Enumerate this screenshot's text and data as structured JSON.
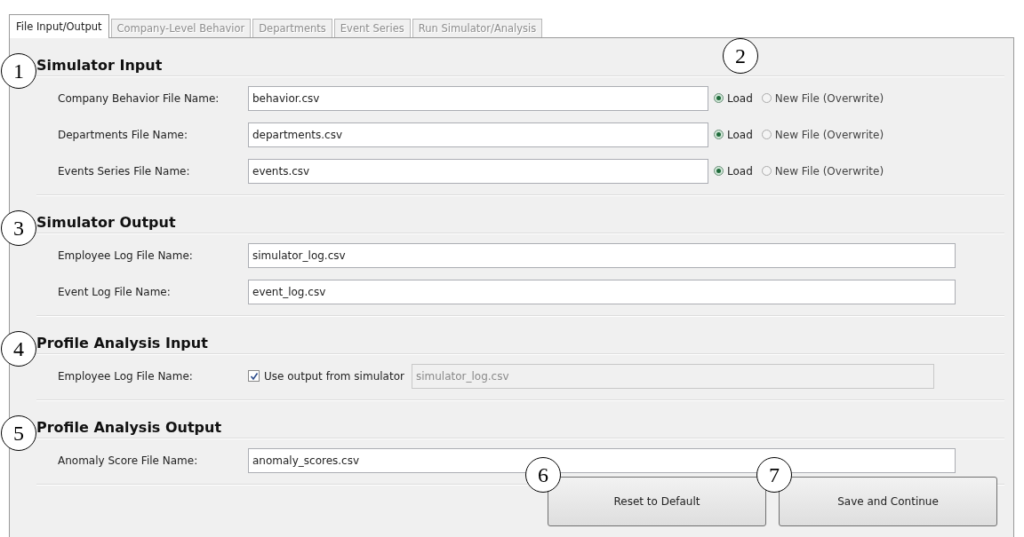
{
  "tabs": [
    {
      "label": "File Input/Output",
      "selected": true,
      "disabled": false
    },
    {
      "label": "Company-Level Behavior",
      "selected": false,
      "disabled": true
    },
    {
      "label": "Departments",
      "selected": false,
      "disabled": true
    },
    {
      "label": "Event Series",
      "selected": false,
      "disabled": true
    },
    {
      "label": "Run Simulator/Analysis",
      "selected": false,
      "disabled": true
    }
  ],
  "sections": [
    {
      "callout": "1",
      "title": "Simulator Input",
      "options_callout": "2",
      "rows": [
        {
          "kind": "file_choice",
          "label": "Company Behavior File Name:",
          "value": "behavior.csv",
          "options": [
            {
              "label": "Load",
              "selected": true
            },
            {
              "label": "New File (Overwrite)",
              "selected": false
            }
          ]
        },
        {
          "kind": "file_choice",
          "label": "Departments File Name:",
          "value": "departments.csv",
          "options": [
            {
              "label": "Load",
              "selected": true
            },
            {
              "label": "New File (Overwrite)",
              "selected": false
            }
          ]
        },
        {
          "kind": "file_choice",
          "label": "Events Series File Name:",
          "value": "events.csv",
          "options": [
            {
              "label": "Load",
              "selected": true
            },
            {
              "label": "New File (Overwrite)",
              "selected": false
            }
          ]
        }
      ]
    },
    {
      "callout": "3",
      "title": "Simulator Output",
      "rows": [
        {
          "kind": "file",
          "label": "Employee Log File Name:",
          "value": "simulator_log.csv"
        },
        {
          "kind": "file",
          "label": "Event Log File Name:",
          "value": "event_log.csv"
        }
      ]
    },
    {
      "callout": "4",
      "title": "Profile Analysis Input",
      "rows": [
        {
          "kind": "checkbox_file",
          "label": "Employee Log File Name:",
          "checkbox": {
            "label": "Use output from simulator",
            "checked": true
          },
          "value": "simulator_log.csv",
          "disabled": true
        }
      ]
    },
    {
      "callout": "5",
      "title": "Profile Analysis Output",
      "rows": [
        {
          "kind": "file",
          "label": "Anomaly Score File Name:",
          "value": "anomaly_scores.csv"
        }
      ]
    }
  ],
  "buttons": [
    {
      "callout": "6",
      "label": "Reset to Default"
    },
    {
      "callout": "7",
      "label": "Save and Continue"
    }
  ]
}
